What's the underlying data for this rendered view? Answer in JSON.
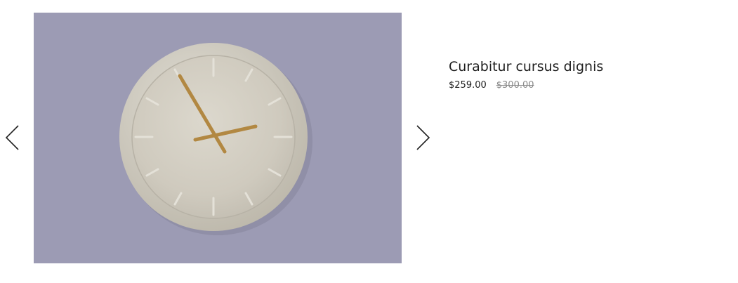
{
  "carousel": {
    "prev_icon": "chevron-left-icon",
    "next_icon": "chevron-right-icon"
  },
  "product": {
    "image_icon": "wall-clock-image",
    "image_background": "#9c9bb4",
    "title": "Curabitur cursus dignis",
    "price": "$259.00",
    "compare_price": "$300.00"
  }
}
